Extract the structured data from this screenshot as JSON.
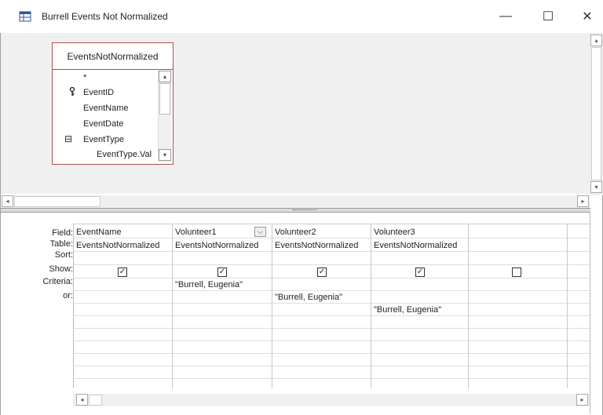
{
  "window": {
    "title": "Burrell Events Not Normalized",
    "minimize_glyph": "—",
    "maximize_glyph": "☐",
    "close_glyph": "✕",
    "icon": "query-design-icon"
  },
  "field_list": {
    "title": "EventsNotNormalized",
    "items": [
      {
        "label": "*",
        "key": false,
        "expander": ""
      },
      {
        "label": "EventID",
        "key": true,
        "expander": ""
      },
      {
        "label": "EventName",
        "key": false,
        "expander": ""
      },
      {
        "label": "EventDate",
        "key": false,
        "expander": ""
      },
      {
        "label": "EventType",
        "key": false,
        "expander": "⊟"
      },
      {
        "label": "EventType.Val",
        "key": false,
        "expander": ""
      }
    ]
  },
  "grid": {
    "row_labels": [
      "Field:",
      "Table:",
      "Sort:",
      "Show:",
      "Criteria:",
      "or:"
    ],
    "columns": [
      {
        "field": "EventName",
        "table": "EventsNotNormalized",
        "sort": "",
        "show": true,
        "criteria": "",
        "or": [
          ""
        ]
      },
      {
        "field": "Volunteer1",
        "table": "EventsNotNormalized",
        "sort": "",
        "show": true,
        "criteria": "\"Burrell,  Eugenia\"",
        "or": [
          ""
        ]
      },
      {
        "field": "Volunteer2",
        "table": "EventsNotNormalized",
        "sort": "",
        "show": true,
        "criteria": "",
        "or": [
          "\"Burrell,  Eugenia\""
        ]
      },
      {
        "field": "Volunteer3",
        "table": "EventsNotNormalized",
        "sort": "",
        "show": true,
        "criteria": "",
        "or": [
          "",
          "\"Burrell,  Eugenia\""
        ]
      },
      {
        "field": "",
        "table": "",
        "sort": "",
        "show": false,
        "criteria": "",
        "or": [
          ""
        ]
      }
    ],
    "dropdown_glyph": "⌵",
    "check_glyph": "✓"
  },
  "scroll": {
    "left_arrow": "◂",
    "right_arrow": "▸",
    "up_arrow": "▴",
    "down_arrow": "▾"
  }
}
